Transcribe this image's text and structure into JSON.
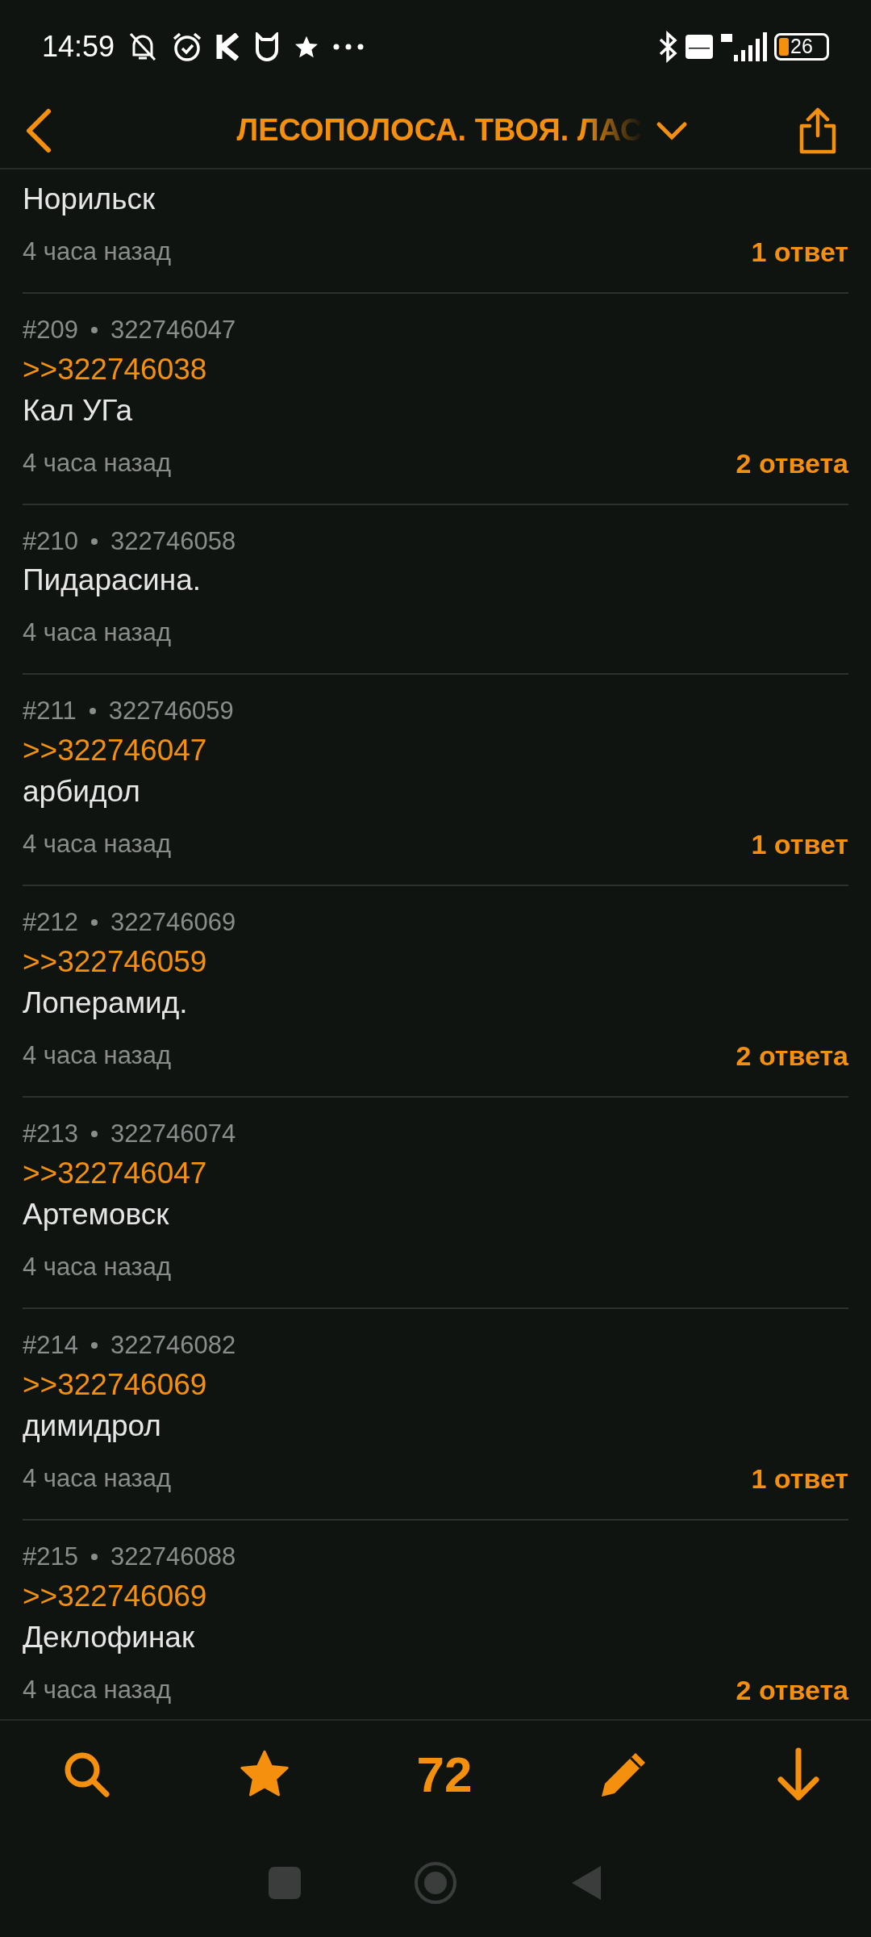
{
  "status_bar": {
    "time": "14:59",
    "battery": "26"
  },
  "header": {
    "title": "ЛЕСОПОЛОСА. ТВОЯ. ЛАС"
  },
  "posts": [
    {
      "text": "Норильск",
      "time": "4 часа назад",
      "replies": "1 ответ"
    },
    {
      "number": "#209",
      "post_id": "322746047",
      "reply_to": ">>322746038",
      "text": "Кал УГа",
      "time": "4 часа назад",
      "replies": "2 ответа"
    },
    {
      "number": "#210",
      "post_id": "322746058",
      "text": "Пидарасина.",
      "time": "4 часа назад"
    },
    {
      "number": "#211",
      "post_id": "322746059",
      "reply_to": ">>322746047",
      "text": "арбидол",
      "time": "4 часа назад",
      "replies": "1 ответ"
    },
    {
      "number": "#212",
      "post_id": "322746069",
      "reply_to": ">>322746059",
      "text": "Лоперамид.",
      "time": "4 часа назад",
      "replies": "2 ответа"
    },
    {
      "number": "#213",
      "post_id": "322746074",
      "reply_to": ">>322746047",
      "text": "Артемовск",
      "time": "4 часа назад"
    },
    {
      "number": "#214",
      "post_id": "322746082",
      "reply_to": ">>322746069",
      "text": "димидрол",
      "time": "4 часа назад",
      "replies": "1 ответ"
    },
    {
      "number": "#215",
      "post_id": "322746088",
      "reply_to": ">>322746069",
      "text": "Деклофинак",
      "time": "4 часа назад",
      "replies": "2 ответа"
    }
  ],
  "bottom_bar": {
    "post_count": "72"
  }
}
